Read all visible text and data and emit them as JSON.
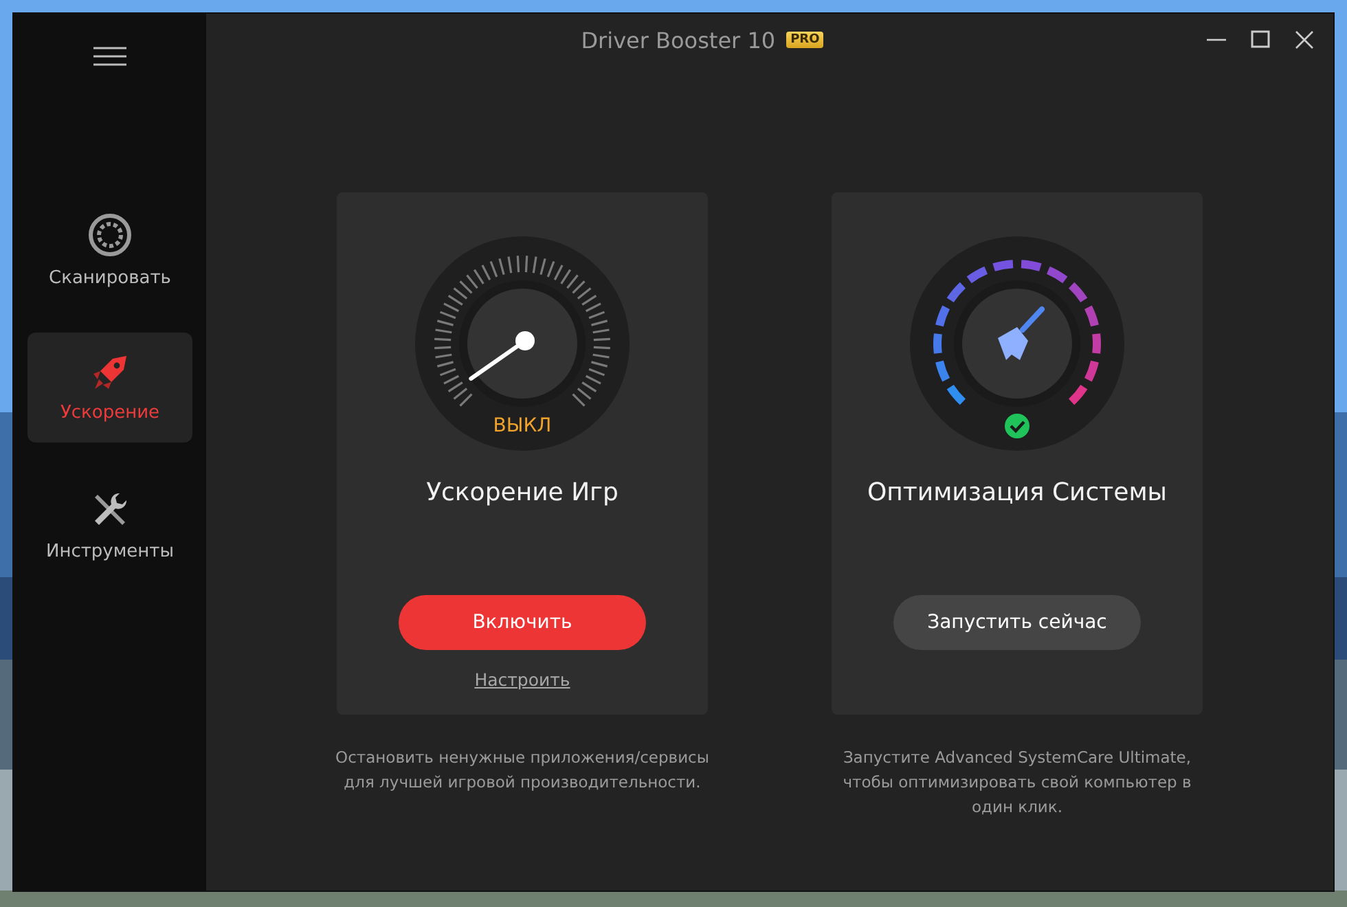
{
  "window": {
    "title": "Driver Booster 10",
    "badge": "PRO"
  },
  "sidebar": {
    "items": [
      {
        "kind": "scan",
        "label": "Сканировать",
        "selected": false
      },
      {
        "kind": "boost",
        "label": "Ускорение",
        "selected": true
      },
      {
        "kind": "tools",
        "label": "Инструменты",
        "selected": false
      }
    ]
  },
  "cards": [
    {
      "kind": "game_boost",
      "title": "Ускорение Игр",
      "status": "ВЫКЛ",
      "on": false,
      "button": "Включить",
      "link": "Настроить",
      "description": "Остановить ненужные приложения/сервисы для лучшей игровой производительности."
    },
    {
      "kind": "system_optimize",
      "title": "Оптимизация Системы",
      "optimized": true,
      "button": "Запустить сейчас",
      "description": "Запустите Advanced SystemCare Ultimate, чтобы оптимизировать свой компьютер в один клик."
    }
  ]
}
